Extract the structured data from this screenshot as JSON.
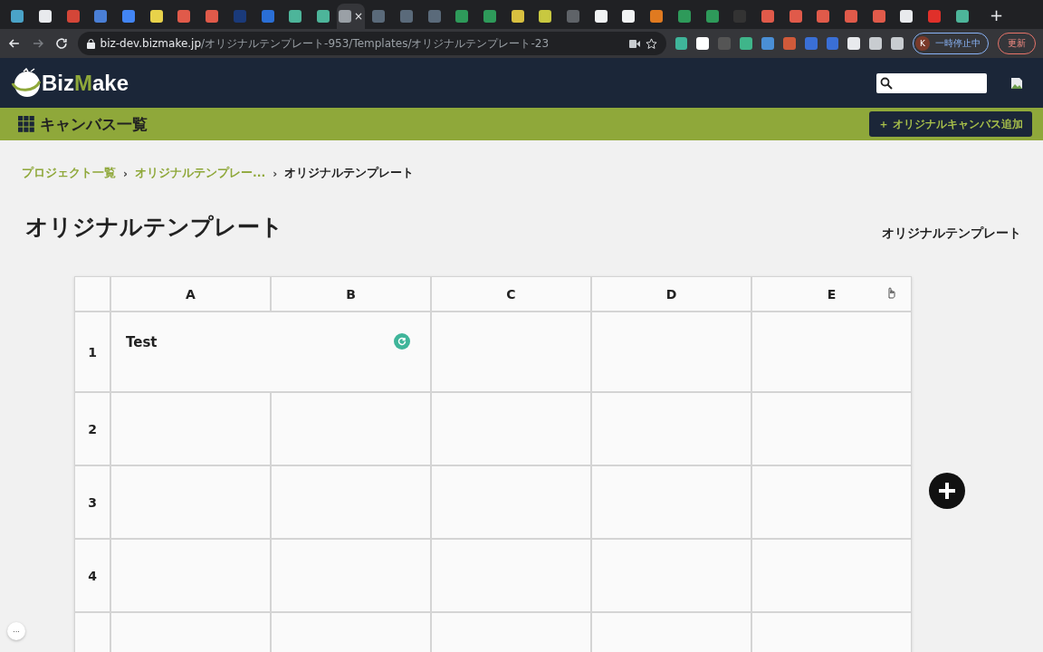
{
  "browser": {
    "tabs": [
      {
        "color": "#4aa3c8",
        "selected": false
      },
      {
        "color": "#e8eaed",
        "selected": false
      },
      {
        "color": "#d44638",
        "selected": false
      },
      {
        "color": "#4a7fd6",
        "selected": false
      },
      {
        "color": "#4285f4",
        "selected": false
      },
      {
        "color": "#e8d24a",
        "selected": false
      },
      {
        "color": "#e05a4a",
        "selected": false
      },
      {
        "color": "#e05a4a",
        "selected": false
      },
      {
        "color": "#1a3a7a",
        "selected": false
      },
      {
        "color": "#2a6fd6",
        "selected": false
      },
      {
        "color": "#4db59a",
        "selected": false
      },
      {
        "color": "#4db59a",
        "selected": false
      },
      {
        "color": "#9aa0a6",
        "selected": true
      },
      {
        "color": "#5a6a7a",
        "selected": false
      },
      {
        "color": "#5a6a7a",
        "selected": false
      },
      {
        "color": "#5a6a7a",
        "selected": false
      },
      {
        "color": "#2e9a5a",
        "selected": false
      },
      {
        "color": "#2e9a5a",
        "selected": false
      },
      {
        "color": "#d8c040",
        "selected": false
      },
      {
        "color": "#c8c840",
        "selected": false
      },
      {
        "color": "#5f6368",
        "selected": false
      },
      {
        "color": "#f1f3f4",
        "selected": false
      },
      {
        "color": "#f1f3f4",
        "selected": false
      },
      {
        "color": "#e07a20",
        "selected": false
      },
      {
        "color": "#2e9a5a",
        "selected": false
      },
      {
        "color": "#2e9a5a",
        "selected": false
      },
      {
        "color": "#333333",
        "selected": false
      },
      {
        "color": "#e05a4a",
        "selected": false
      },
      {
        "color": "#e05a4a",
        "selected": false
      },
      {
        "color": "#e05a4a",
        "selected": false
      },
      {
        "color": "#e05a4a",
        "selected": false
      },
      {
        "color": "#e05a4a",
        "selected": false
      },
      {
        "color": "#e8eaed",
        "selected": false
      },
      {
        "color": "#e0302a",
        "selected": false
      },
      {
        "color": "#4db59a",
        "selected": false
      }
    ],
    "tab_close": "×",
    "new_tab": "+",
    "url_host": "biz-dev.bizmake.jp",
    "url_path": "/オリジナルテンプレート-953/Templates/オリジナルテンプレート-23",
    "extensions": [
      {
        "color": "#3fb59a"
      },
      {
        "color": "#ffffff"
      },
      {
        "color": "#555555"
      },
      {
        "color": "#3fb58a"
      },
      {
        "color": "#4a8fd6"
      },
      {
        "color": "#d05a3a"
      },
      {
        "color": "#3a6fd6"
      },
      {
        "color": "#3a6fd6"
      },
      {
        "color": "#e8eaed"
      },
      {
        "color": "#c8ccd0"
      },
      {
        "color": "#c8ccd0"
      }
    ],
    "profile_initial": "K",
    "profile_status": "一時停止中",
    "update_label": "更新"
  },
  "header": {
    "logo": {
      "left": "Biz",
      "accent": "M",
      "right": "ake"
    }
  },
  "toolbar": {
    "title": "キャンバス一覧",
    "add_button": "＋ オリジナルキャンバス追加"
  },
  "breadcrumb": [
    {
      "label": "プロジェクト一覧",
      "current": false
    },
    {
      "label": "オリジナルテンプレー...",
      "current": false
    },
    {
      "label": "オリジナルテンプレート",
      "current": true
    }
  ],
  "breadcrumb_separator": "›",
  "page": {
    "title": "オリジナルテンプレート",
    "side_label": "オリジナルテンプレート"
  },
  "grid": {
    "columns": [
      "A",
      "B",
      "C",
      "D",
      "E"
    ],
    "rows": [
      {
        "label": "1",
        "cells": [
          {
            "kind": "merged",
            "text": "Test"
          },
          {
            "kind": "empty"
          },
          {
            "kind": "empty"
          },
          {
            "kind": "empty"
          }
        ]
      },
      {
        "label": "2",
        "cells": [
          {
            "kind": "empty"
          },
          {
            "kind": "empty"
          },
          {
            "kind": "empty"
          },
          {
            "kind": "empty"
          },
          {
            "kind": "empty"
          }
        ]
      },
      {
        "label": "3",
        "cells": [
          {
            "kind": "empty"
          },
          {
            "kind": "empty"
          },
          {
            "kind": "empty"
          },
          {
            "kind": "empty"
          },
          {
            "kind": "empty"
          }
        ]
      },
      {
        "label": "4",
        "cells": [
          {
            "kind": "empty"
          },
          {
            "kind": "empty"
          },
          {
            "kind": "empty"
          },
          {
            "kind": "empty"
          },
          {
            "kind": "empty"
          }
        ]
      },
      {
        "cells": [
          {
            "kind": "empty"
          },
          {
            "kind": "empty"
          },
          {
            "kind": "empty"
          },
          {
            "kind": "empty"
          },
          {
            "kind": "empty"
          }
        ]
      }
    ]
  },
  "more_button": "···"
}
